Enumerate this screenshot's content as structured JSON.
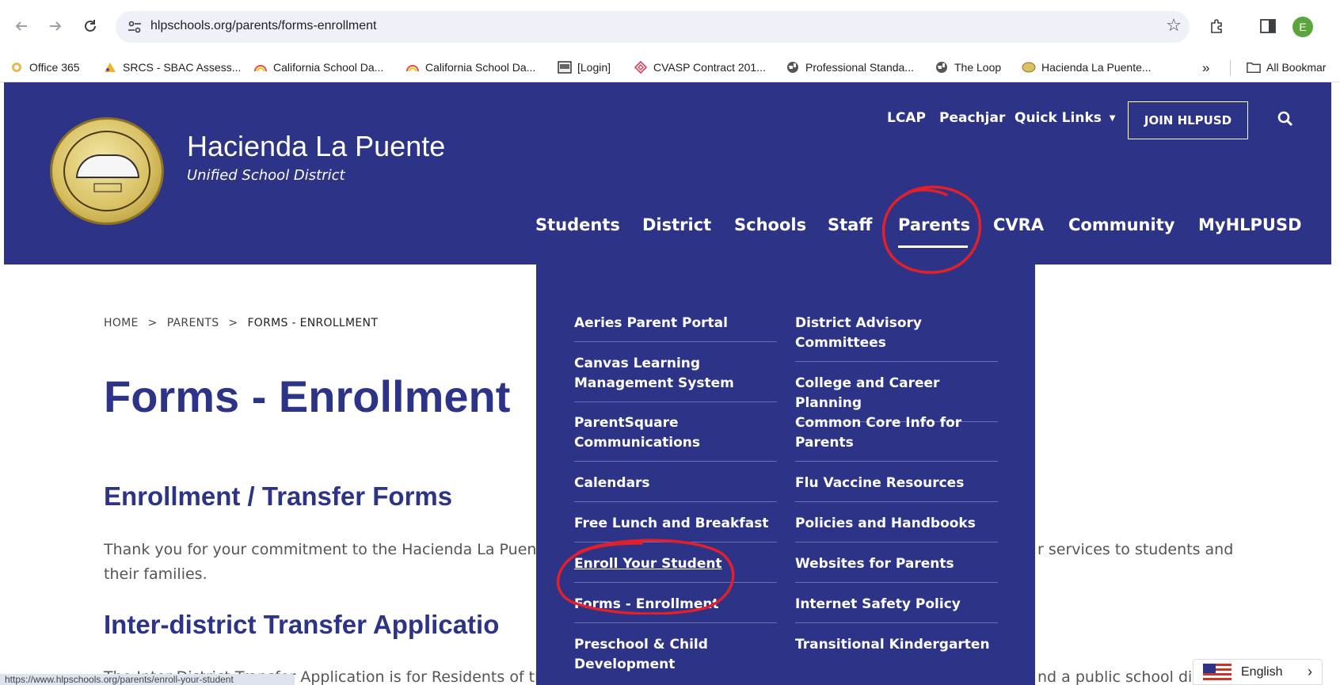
{
  "browser": {
    "url": "hlpschools.org/parents/forms-enrollment",
    "profile_initial": "E",
    "status_url": "https://www.hlpschools.org/parents/enroll-your-student",
    "more_chevron": "»",
    "all_bookmarks": "All Bookmar"
  },
  "bookmarks": [
    {
      "label": "Office 365",
      "icon": "office-icon"
    },
    {
      "label": "SRCS - SBAC Assess...",
      "icon": "sbac-icon"
    },
    {
      "label": "California School Da...",
      "icon": "dashboard-gauge-icon"
    },
    {
      "label": "California School Da...",
      "icon": "dashboard-gauge-icon"
    },
    {
      "label": "[Login]",
      "icon": "login-page-icon"
    },
    {
      "label": "CVASP Contract 201...",
      "icon": "cvasp-icon"
    },
    {
      "label": "Professional Standa...",
      "icon": "globe-icon"
    },
    {
      "label": "The Loop",
      "icon": "globe-icon"
    },
    {
      "label": "Hacienda La Puente...",
      "icon": "hlpusd-icon"
    }
  ],
  "site": {
    "name": "Hacienda La Puente",
    "subtitle": "Unified School District",
    "logo": {
      "top_text": "HACIENDA LA PUENTE",
      "bottom_text": "UNIFIED SCHOOL DISTRICT",
      "year": "1970"
    },
    "utility": [
      "LCAP",
      "Peachjar",
      "Quick Links"
    ],
    "join_label": "JOIN HLPUSD",
    "nav": [
      "Students",
      "District",
      "Schools",
      "Staff",
      "Parents",
      "CVRA",
      "Community",
      "MyHLPUSD"
    ],
    "active_nav": "Parents"
  },
  "breadcrumb": {
    "home": "HOME",
    "parent": "PARENTS",
    "current": "FORMS - ENROLLMENT",
    "sep": ">"
  },
  "page": {
    "title": "Forms - Enrollment",
    "section1_heading": "Enrollment / Transfer Forms",
    "section1_line1_left": "Thank you for your commitment to the Hacienda La Puente U",
    "section1_line1_right": "r services to students and",
    "section1_line2": "their families.",
    "section2_heading": "Inter-district Transfer Applicatio",
    "section2_line_left": "The Inter-District Transfer Application is for Residents of the",
    "section2_line_right": "nd a public school distr"
  },
  "dropdown": {
    "left": [
      "Aeries Parent Portal",
      "Canvas Learning Management System",
      "ParentSquare Communications",
      "Calendars",
      "Free Lunch and Breakfast",
      "Enroll Your Student",
      "Forms - Enrollment",
      "Preschool & Child Development"
    ],
    "right": [
      "District Advisory Committees",
      "College and Career Planning",
      "Common Core Info for Parents",
      "Flu Vaccine Resources",
      "Policies and Handbooks",
      "Websites for Parents",
      "Internet Safety Policy",
      "Transitional Kindergarten"
    ]
  },
  "language": "English",
  "colors": {
    "brand": "#2d3387",
    "annotation": "#e0202a"
  }
}
